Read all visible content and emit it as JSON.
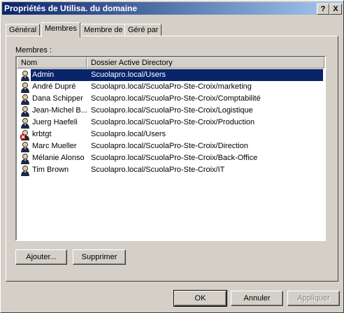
{
  "window": {
    "title": "Propriétés de Utilisa. du domaine",
    "help_button": "?",
    "close_button": "X"
  },
  "tabs": [
    {
      "label": "Général",
      "active": false
    },
    {
      "label": "Membres",
      "active": true
    },
    {
      "label": "Membre de",
      "active": false
    },
    {
      "label": "Géré par",
      "active": false
    }
  ],
  "members": {
    "label": "Membres :",
    "columns": {
      "name": "Nom",
      "folder": "Dossier Active Directory"
    },
    "rows": [
      {
        "name": "Admin",
        "folder": "Scuolapro.local/Users",
        "icon": "user-icon",
        "selected": true
      },
      {
        "name": "André Dupré",
        "folder": "Scuolapro.local/ScuolaPro-Ste-Croix/marketing",
        "icon": "user-icon"
      },
      {
        "name": "Dana Schipper",
        "folder": "Scuolapro.local/ScuolaPro-Ste-Croix/Comptabilité",
        "icon": "user-icon"
      },
      {
        "name": "Jean-Michel B...",
        "folder": "Scuolapro.local/ScuolaPro-Ste-Croix/Logistique",
        "icon": "user-icon"
      },
      {
        "name": "Juerg Haefeli",
        "folder": "Scuolapro.local/ScuolaPro-Ste-Croix/Production",
        "icon": "user-icon"
      },
      {
        "name": "krbtgt",
        "folder": "Scuolapro.local/Users",
        "icon": "disabled-user-icon"
      },
      {
        "name": "Marc Mueller",
        "folder": "Scuolapro.local/ScuolaPro-Ste-Croix/Direction",
        "icon": "user-icon"
      },
      {
        "name": "Mélanie Alonso",
        "folder": "Scuolapro.local/ScuolaPro-Ste-Croix/Back-Office",
        "icon": "user-icon"
      },
      {
        "name": "Tim Brown",
        "folder": "Scuolapro.local/ScuolaPro-Ste-Croix/IT",
        "icon": "user-icon"
      }
    ],
    "add_button": "Ajouter...",
    "remove_button": "Supprimer"
  },
  "footer": {
    "ok": "OK",
    "cancel": "Annuler",
    "apply": "Appliquer"
  },
  "colors": {
    "selection": "#0a246a",
    "face": "#d4d0c8"
  }
}
